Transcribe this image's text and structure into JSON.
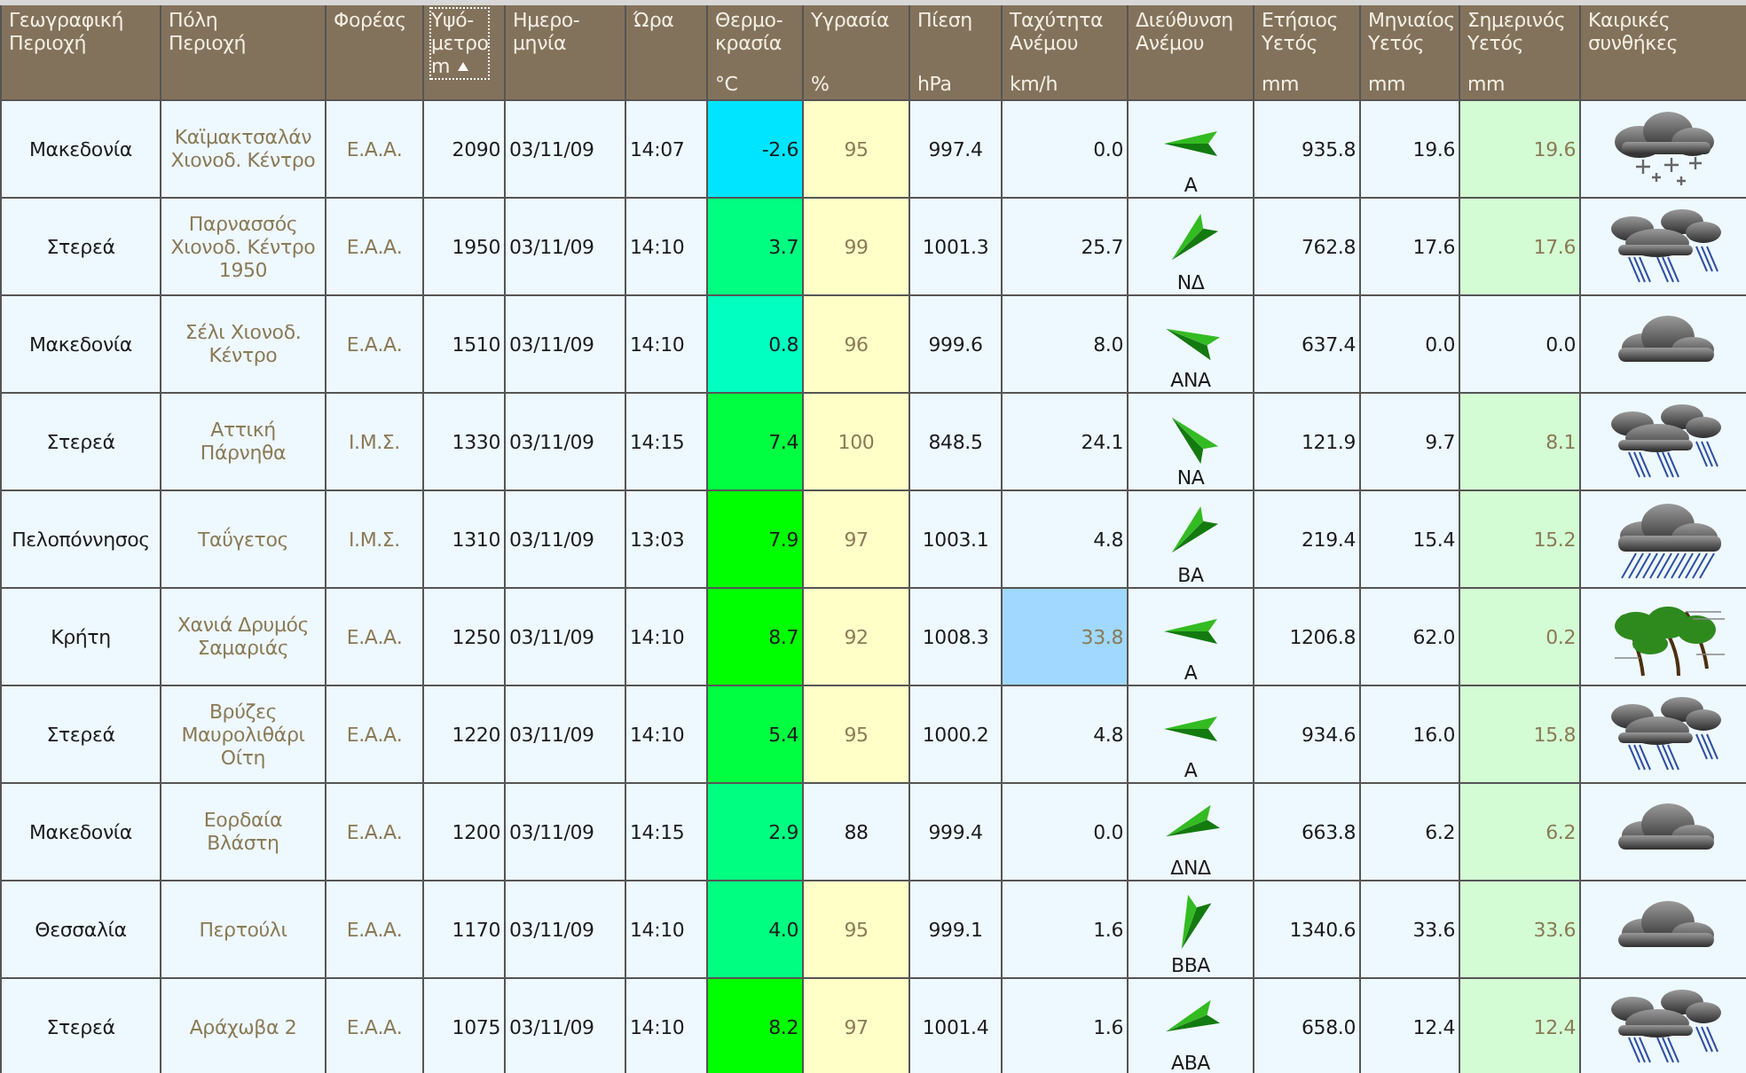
{
  "table": {
    "columns": [
      {
        "lines": [
          "Γεωγραφική",
          "Περιοχή"
        ],
        "sorted": false
      },
      {
        "lines": [
          "Πόλη",
          "Περιοχή"
        ],
        "sorted": false
      },
      {
        "lines": [
          "Φορέας"
        ],
        "sorted": false
      },
      {
        "lines": [
          "Υψό-",
          "μετρο",
          "m"
        ],
        "sorted": true
      },
      {
        "lines": [
          "Ημερο-",
          "μηνία"
        ],
        "sorted": false
      },
      {
        "lines": [
          "Ώρα"
        ],
        "sorted": false
      },
      {
        "lines": [
          "Θερμο-",
          "κρασία"
        ],
        "unit": "°C",
        "sorted": false
      },
      {
        "lines": [
          "Υγρασία"
        ],
        "unit": "%",
        "sorted": false
      },
      {
        "lines": [
          "Πίεση"
        ],
        "unit": "hPa",
        "sorted": false
      },
      {
        "lines": [
          "Ταχύτητα",
          "Ανέμου"
        ],
        "unit": "km/h",
        "sorted": false
      },
      {
        "lines": [
          "Διεύθυνση",
          "Ανέμου"
        ],
        "sorted": false
      },
      {
        "lines": [
          "Ετήσιος",
          "Υετός"
        ],
        "unit": "mm",
        "sorted": false
      },
      {
        "lines": [
          "Μηνιαίος",
          "Υετός"
        ],
        "unit": "mm",
        "sorted": false
      },
      {
        "lines": [
          "Σημερινός",
          "Υετός"
        ],
        "unit": "mm",
        "sorted": false
      },
      {
        "lines": [
          "Καιρικές",
          "συνθήκες"
        ],
        "sorted": false
      }
    ],
    "rows": [
      {
        "region": "Μακεδονία",
        "city": "Καϊμακτσαλάν Χιονοδ. Κέντρο",
        "agency": "Ε.Α.Α.",
        "altitude": "2090",
        "date": "03/11/09",
        "time": "14:07",
        "temperature": {
          "value": "-2.6",
          "color": "#00e5ff"
        },
        "humidity": {
          "value": "95",
          "highlighted": true
        },
        "pressure": "997.4",
        "wind_speed": {
          "value": "0.0",
          "highlighted": false
        },
        "wind_direction": {
          "label": "Α",
          "kind": "east"
        },
        "rain_year": "935.8",
        "rain_month": "19.6",
        "rain_today": {
          "value": "19.6",
          "highlighted": true
        },
        "conditions": {
          "kind": "snow"
        }
      },
      {
        "region": "Στερεά",
        "city": "Παρνασσός Χιονοδ. Κέντρο 1950",
        "agency": "Ε.Α.Α.",
        "altitude": "1950",
        "date": "03/11/09",
        "time": "14:10",
        "temperature": {
          "value": "3.7",
          "color": "#00ff80"
        },
        "humidity": {
          "value": "99",
          "highlighted": true
        },
        "pressure": "1001.3",
        "wind_speed": {
          "value": "25.7",
          "highlighted": false
        },
        "wind_direction": {
          "label": "ΝΔ",
          "kind": "northeast"
        },
        "rain_year": "762.8",
        "rain_month": "17.6",
        "rain_today": {
          "value": "17.6",
          "highlighted": true
        },
        "conditions": {
          "kind": "showers"
        }
      },
      {
        "region": "Μακεδονία",
        "city": "Σέλι Χιονοδ. Κέντρο",
        "agency": "Ε.Α.Α.",
        "altitude": "1510",
        "date": "03/11/09",
        "time": "14:10",
        "temperature": {
          "value": "0.8",
          "color": "#00ffc0"
        },
        "humidity": {
          "value": "96",
          "highlighted": true
        },
        "pressure": "999.6",
        "wind_speed": {
          "value": "8.0",
          "highlighted": false
        },
        "wind_direction": {
          "label": "ΑΝΑ",
          "kind": "eastsoutheast"
        },
        "rain_year": "637.4",
        "rain_month": "0.0",
        "rain_today": {
          "value": "0.0",
          "highlighted": false
        },
        "conditions": {
          "kind": "cloudy"
        }
      },
      {
        "region": "Στερεά",
        "city": "Αττική Πάρνηθα",
        "agency": "Ι.Μ.Σ.",
        "altitude": "1330",
        "date": "03/11/09",
        "time": "14:15",
        "temperature": {
          "value": "7.4",
          "color": "#00ff40"
        },
        "humidity": {
          "value": "100",
          "highlighted": true
        },
        "pressure": "848.5",
        "wind_speed": {
          "value": "24.1",
          "highlighted": false
        },
        "wind_direction": {
          "label": "ΝΑ",
          "kind": "southeast"
        },
        "rain_year": "121.9",
        "rain_month": "9.7",
        "rain_today": {
          "value": "8.1",
          "highlighted": true
        },
        "conditions": {
          "kind": "showers"
        }
      },
      {
        "region": "Πελοπόννησος",
        "city": "Ταΰγετος",
        "agency": "Ι.Μ.Σ.",
        "altitude": "1310",
        "date": "03/11/09",
        "time": "13:03",
        "temperature": {
          "value": "7.9",
          "color": "#00ff00"
        },
        "humidity": {
          "value": "97",
          "highlighted": true
        },
        "pressure": "1003.1",
        "wind_speed": {
          "value": "4.8",
          "highlighted": false
        },
        "wind_direction": {
          "label": "ΒΑ",
          "kind": "northeast"
        },
        "rain_year": "219.4",
        "rain_month": "15.4",
        "rain_today": {
          "value": "15.2",
          "highlighted": true
        },
        "conditions": {
          "kind": "rain"
        }
      },
      {
        "region": "Κρήτη",
        "city": "Χανιά Δρυμός Σαμαριάς",
        "agency": "Ε.Α.Α.",
        "altitude": "1250",
        "date": "03/11/09",
        "time": "14:10",
        "temperature": {
          "value": "8.7",
          "color": "#00ff00"
        },
        "humidity": {
          "value": "92",
          "highlighted": true
        },
        "pressure": "1008.3",
        "wind_speed": {
          "value": "33.8",
          "highlighted": true
        },
        "wind_direction": {
          "label": "Α",
          "kind": "east"
        },
        "rain_year": "1206.8",
        "rain_month": "62.0",
        "rain_today": {
          "value": "0.2",
          "highlighted": true
        },
        "conditions": {
          "kind": "gale"
        }
      },
      {
        "region": "Στερεά",
        "city": "Βρύζες Μαυρολιθάρι Οίτη",
        "agency": "Ε.Α.Α.",
        "altitude": "1220",
        "date": "03/11/09",
        "time": "14:10",
        "temperature": {
          "value": "5.4",
          "color": "#00ff40"
        },
        "humidity": {
          "value": "95",
          "highlighted": true
        },
        "pressure": "1000.2",
        "wind_speed": {
          "value": "4.8",
          "highlighted": false
        },
        "wind_direction": {
          "label": "Α",
          "kind": "east"
        },
        "rain_year": "934.6",
        "rain_month": "16.0",
        "rain_today": {
          "value": "15.8",
          "highlighted": true
        },
        "conditions": {
          "kind": "showers"
        }
      },
      {
        "region": "Μακεδονία",
        "city": "Εορδαία Βλάστη",
        "agency": "Ε.Α.Α.",
        "altitude": "1200",
        "date": "03/11/09",
        "time": "14:15",
        "temperature": {
          "value": "2.9",
          "color": "#00ff80"
        },
        "humidity": {
          "value": "88",
          "highlighted": false
        },
        "pressure": "999.4",
        "wind_speed": {
          "value": "0.0",
          "highlighted": false
        },
        "wind_direction": {
          "label": "ΔΝΔ",
          "kind": "eastnortheast"
        },
        "rain_year": "663.8",
        "rain_month": "6.2",
        "rain_today": {
          "value": "6.2",
          "highlighted": true
        },
        "conditions": {
          "kind": "cloudy"
        }
      },
      {
        "region": "Θεσσαλία",
        "city": "Περτούλι",
        "agency": "Ε.Α.Α.",
        "altitude": "1170",
        "date": "03/11/09",
        "time": "14:10",
        "temperature": {
          "value": "4.0",
          "color": "#00ff80"
        },
        "humidity": {
          "value": "95",
          "highlighted": true
        },
        "pressure": "999.1",
        "wind_speed": {
          "value": "1.6",
          "highlighted": false
        },
        "wind_direction": {
          "label": "ΒΒΑ",
          "kind": "northnortheast"
        },
        "rain_year": "1340.6",
        "rain_month": "33.6",
        "rain_today": {
          "value": "33.6",
          "highlighted": true
        },
        "conditions": {
          "kind": "cloudy"
        }
      },
      {
        "region": "Στερεά",
        "city": "Αράχωβα 2",
        "agency": "Ε.Α.Α.",
        "altitude": "1075",
        "date": "03/11/09",
        "time": "14:10",
        "temperature": {
          "value": "8.2",
          "color": "#00ff00"
        },
        "humidity": {
          "value": "97",
          "highlighted": true
        },
        "pressure": "1001.4",
        "wind_speed": {
          "value": "1.6",
          "highlighted": false
        },
        "wind_direction": {
          "label": "ΑΒΑ",
          "kind": "eastnortheast"
        },
        "rain_year": "658.0",
        "rain_month": "12.4",
        "rain_today": {
          "value": "12.4",
          "highlighted": true
        },
        "conditions": {
          "kind": "showers"
        }
      }
    ]
  }
}
